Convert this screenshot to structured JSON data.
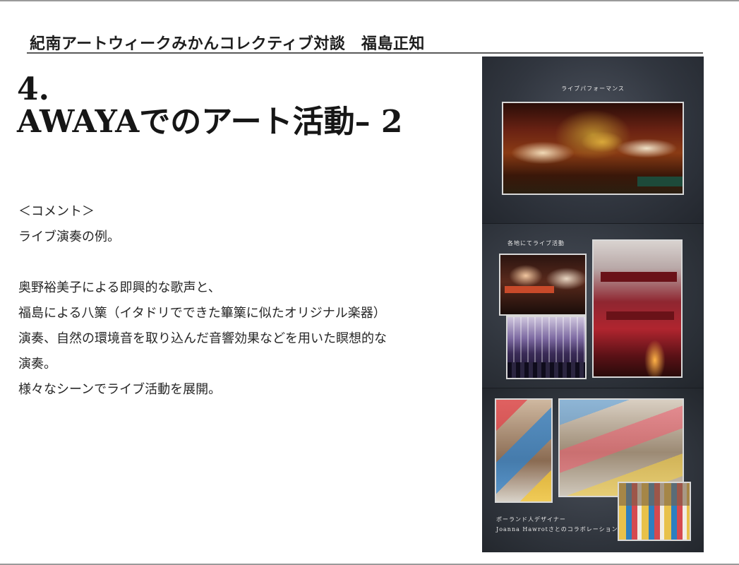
{
  "header": {
    "title": "紀南アートウィークみかんコレクティブ対談　福島正知"
  },
  "slide": {
    "title_line1": "4.",
    "title_line2": "AWAYAでのアート活動– 2"
  },
  "comment": {
    "heading": "＜コメント＞",
    "line1": "ライブ演奏の例。",
    "line2": "奥野裕美子による即興的な歌声と、",
    "line3": "福島による八篥（イタドリでできた篳篥に似たオリジナル楽器）",
    "line4": "演奏、自然の環境音を取り込んだ音響効果などを用いた瞑想的な",
    "line5": "演奏。",
    "line6": "様々なシーンでライブ活動を展開。"
  },
  "collage": {
    "caption1": "ライブパフォーマンス",
    "caption2": "各地にてライブ活動",
    "caption3_line1": "ポーランド人デザイナー",
    "caption3_line2": "Joanna Hawrotさとのコラボレーション"
  }
}
